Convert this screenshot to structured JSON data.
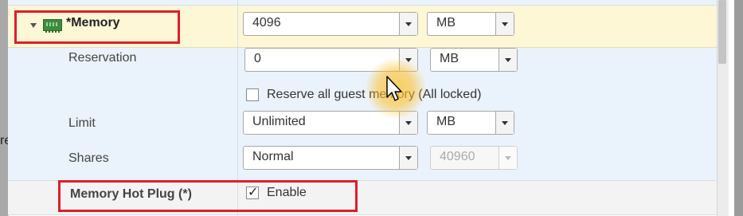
{
  "sidebar": {
    "cut_text": "re"
  },
  "memory": {
    "label": "*Memory",
    "value": "4096",
    "unit": "MB"
  },
  "reservation": {
    "label": "Reservation",
    "value": "0",
    "unit": "MB",
    "reserve_all_label": "Reserve all guest memory (All locked)",
    "reserve_all_checked": false
  },
  "limit": {
    "label": "Limit",
    "value": "Unlimited",
    "unit": "MB"
  },
  "shares": {
    "label": "Shares",
    "value": "Normal",
    "amount": "40960"
  },
  "hot_plug": {
    "label": "Memory Hot Plug (*)",
    "enable_label": "Enable",
    "enabled": true
  },
  "colors": {
    "highlight_box": "#e11d2a",
    "memory_row_bg": "#fdf7d6",
    "sub_rows_bg": "#eaf3fb",
    "cursor_glow": "#ffc83c"
  }
}
